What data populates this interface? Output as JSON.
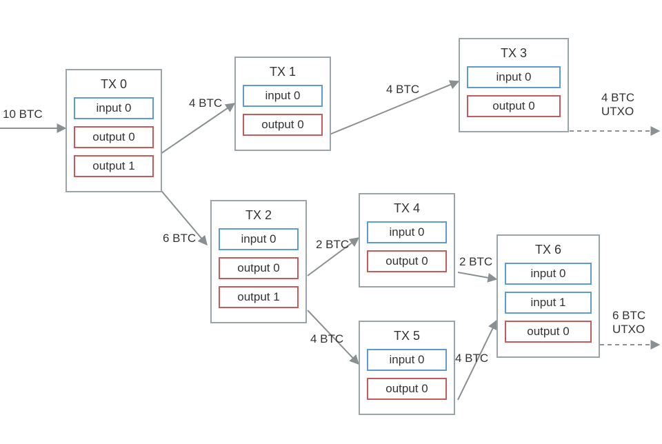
{
  "transactions": {
    "tx0": {
      "title": "TX 0",
      "inputs": [
        "input 0"
      ],
      "outputs": [
        "output 0",
        "output 1"
      ]
    },
    "tx1": {
      "title": "TX 1",
      "inputs": [
        "input 0"
      ],
      "outputs": [
        "output 0"
      ]
    },
    "tx2": {
      "title": "TX 2",
      "inputs": [
        "input 0"
      ],
      "outputs": [
        "output 0",
        "output 1"
      ]
    },
    "tx3": {
      "title": "TX 3",
      "inputs": [
        "input 0"
      ],
      "outputs": [
        "output 0"
      ]
    },
    "tx4": {
      "title": "TX 4",
      "inputs": [
        "input 0"
      ],
      "outputs": [
        "output 0"
      ]
    },
    "tx5": {
      "title": "TX 5",
      "inputs": [
        "input 0"
      ],
      "outputs": [
        "output 0"
      ]
    },
    "tx6": {
      "title": "TX 6",
      "inputs": [
        "input 0",
        "input 1"
      ],
      "outputs": [
        "output 0"
      ]
    }
  },
  "edge_labels": {
    "in0": "10 BTC",
    "tx0_tx1": "4 BTC",
    "tx1_tx3": "4 BTC",
    "tx3_out": "4 BTC\nUTXO",
    "tx0_tx2": "6 BTC",
    "tx2_tx4": "2 BTC",
    "tx4_tx6": "2 BTC",
    "tx2_tx5": "4 BTC",
    "tx5_tx6": "4 BTC",
    "tx6_out": "6 BTC\nUTXO"
  },
  "chart_data": {
    "type": "diagram",
    "nodes": [
      {
        "id": "TX0",
        "inputs": 1,
        "outputs": 2
      },
      {
        "id": "TX1",
        "inputs": 1,
        "outputs": 1
      },
      {
        "id": "TX2",
        "inputs": 1,
        "outputs": 2
      },
      {
        "id": "TX3",
        "inputs": 1,
        "outputs": 1
      },
      {
        "id": "TX4",
        "inputs": 1,
        "outputs": 1
      },
      {
        "id": "TX5",
        "inputs": 1,
        "outputs": 1
      },
      {
        "id": "TX6",
        "inputs": 2,
        "outputs": 1
      }
    ],
    "edges": [
      {
        "from": "source",
        "to": "TX0.input0",
        "amount_btc": 10
      },
      {
        "from": "TX0.output0",
        "to": "TX1.input0",
        "amount_btc": 4
      },
      {
        "from": "TX0.output1",
        "to": "TX2.input0",
        "amount_btc": 6
      },
      {
        "from": "TX1.output0",
        "to": "TX3.input0",
        "amount_btc": 4
      },
      {
        "from": "TX3.output0",
        "to": "UTXO",
        "amount_btc": 4
      },
      {
        "from": "TX2.output0",
        "to": "TX4.input0",
        "amount_btc": 2
      },
      {
        "from": "TX2.output1",
        "to": "TX5.input0",
        "amount_btc": 4
      },
      {
        "from": "TX4.output0",
        "to": "TX6.input0",
        "amount_btc": 2
      },
      {
        "from": "TX5.output0",
        "to": "TX6.input1",
        "amount_btc": 4
      },
      {
        "from": "TX6.output0",
        "to": "UTXO",
        "amount_btc": 6
      }
    ]
  }
}
